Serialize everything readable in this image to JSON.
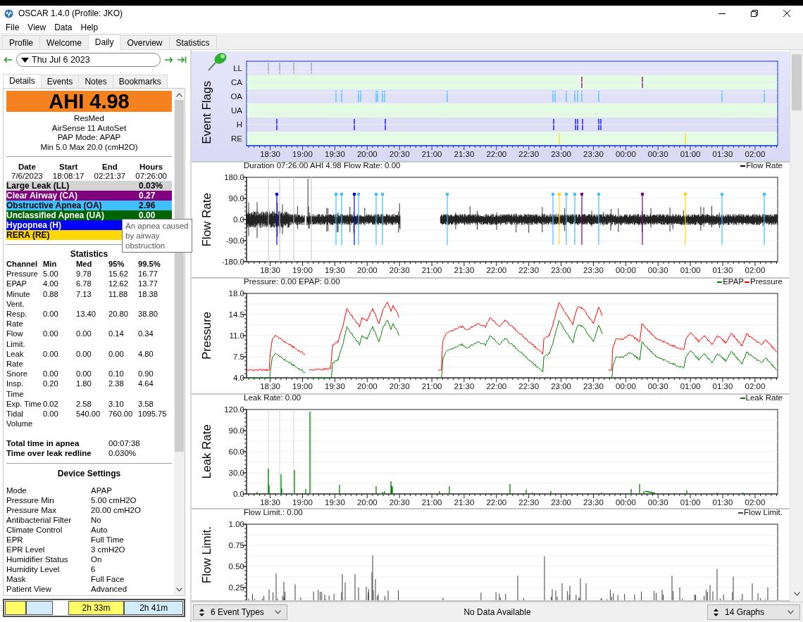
{
  "window": {
    "title": "OSCAR 1.4.0 (Profile: JKO)"
  },
  "menu": [
    "File",
    "View",
    "Data",
    "Help"
  ],
  "tabs": [
    {
      "label": "Profile",
      "selected": false
    },
    {
      "label": "Welcome",
      "selected": false
    },
    {
      "label": "Daily",
      "selected": true
    },
    {
      "label": "Overview",
      "selected": false
    },
    {
      "label": "Statistics",
      "selected": false
    }
  ],
  "date_nav": {
    "date": "Thu Jul 6 2023"
  },
  "detail_tabs": [
    {
      "label": "Details",
      "selected": true
    },
    {
      "label": "Events",
      "selected": false
    },
    {
      "label": "Notes",
      "selected": false
    },
    {
      "label": "Bookmarks",
      "selected": false
    }
  ],
  "summary": {
    "ahi": "AHI 4.98",
    "device": [
      "ResMed",
      "AirSense 11 AutoSet",
      "PAP Mode: APAP",
      "Min 5.0 Max 20.0 (cmH2O)"
    ]
  },
  "session": {
    "columns": [
      "Date",
      "Start",
      "End",
      "Hours"
    ],
    "values": [
      "7/6/2023",
      "18:08:17",
      "02:21:37",
      "07:26:00"
    ]
  },
  "indices": [
    {
      "label": "Large Leak (LL)",
      "value": "0.03%",
      "color": "#d3d3d3"
    },
    {
      "label": "Clear Airway (CA)",
      "value": "0.27",
      "color": "#800080"
    },
    {
      "label": "Obstructive Apnea (OA)",
      "value": "2.96",
      "color": "#40c0ff"
    },
    {
      "label": "Unclassified Apnea (UA)",
      "value": "0.00",
      "color": "#006400"
    },
    {
      "label": "Hypopnea (H)",
      "color": "#0000ff"
    },
    {
      "label": "RERA (RE)",
      "color": "#ffd700"
    }
  ],
  "tooltip": "An apnea caused by airway obstruction",
  "statistics": {
    "title": "Statistics",
    "columns": [
      "Channel",
      "Min",
      "Med",
      "95%",
      "99.5%"
    ],
    "rows": [
      [
        "Pressure",
        "5.00",
        "9.78",
        "15.62",
        "16.77"
      ],
      [
        "EPAP",
        "4.00",
        "6.78",
        "12.62",
        "13.77"
      ],
      [
        "Minute Vent.",
        "0.88",
        "7.13",
        "11.88",
        "18.38"
      ],
      [
        "Resp. Rate",
        "0.00",
        "13.40",
        "20.80",
        "38.80"
      ],
      [
        "Flow Limit.",
        "0.00",
        "0.00",
        "0.14",
        "0.34"
      ],
      [
        "Leak Rate",
        "0.00",
        "0.00",
        "0.00",
        "4.80"
      ],
      [
        "Snore",
        "0.00",
        "0.00",
        "0.10",
        "0.90"
      ],
      [
        "Insp. Time",
        "0.20",
        "1.80",
        "2.38",
        "4.64"
      ],
      [
        "Exp. Time",
        "0.02",
        "2.58",
        "3.10",
        "3.58"
      ],
      [
        "Tidal Volume",
        "0.00",
        "540.00",
        "760.00",
        "1095.75"
      ]
    ]
  },
  "totals": [
    {
      "label": "Total time in apnea",
      "value": "00:07:38"
    },
    {
      "label": "Time over leak redline",
      "value": "0.030%"
    }
  ],
  "device_settings": {
    "title": "Device Settings",
    "rows": [
      [
        "Mode",
        "APAP"
      ],
      [
        "Pressure Min",
        "5.00 cmH2O"
      ],
      [
        "Pressure Max",
        "20.00 cmH2O"
      ],
      [
        "Antibacterial Filter",
        "No"
      ],
      [
        "Climate Control",
        "Auto"
      ],
      [
        "EPR",
        "Full Time"
      ],
      [
        "EPR Level",
        "3 cmH2O"
      ],
      [
        "Humidifier Status",
        "On"
      ],
      [
        "Humidity Level",
        "6"
      ],
      [
        "Mask",
        "Full Face"
      ],
      [
        "Patient View",
        "Advanced"
      ]
    ]
  },
  "timeline": [
    {
      "kind": "session",
      "color": "#ffff66"
    },
    {
      "kind": "session",
      "color": "#d4ecfa"
    },
    {
      "kind": "gap"
    },
    {
      "kind": "session",
      "color": "#ffff66",
      "label": "2h 33m"
    },
    {
      "kind": "session",
      "color": "#d4ecfa",
      "label": "2h 41m"
    }
  ],
  "graphs": [
    {
      "kind": "flags",
      "title": "Event Flags",
      "rows": [
        "LL",
        "CA",
        "OA",
        "UA",
        "H",
        "RE"
      ],
      "xticks": [
        "18:30",
        "19:00",
        "19:30",
        "20:00",
        "20:30",
        "21:00",
        "21:30",
        "22:00",
        "22:30",
        "23:00",
        "23:30",
        "00:00",
        "00:30",
        "01:00",
        "01:30",
        "02:00"
      ]
    },
    {
      "kind": "flow",
      "title": "Flow Rate",
      "info": "Duration 07:26:00 AHI 4.98 Flow Rate: 0.00",
      "legend": [
        {
          "label": "Flow Rate",
          "color": "#000000"
        }
      ],
      "yticks": [
        "180.0",
        "90.0",
        "0.0",
        "-90.0",
        "-180.0"
      ],
      "xticks": [
        "18:30",
        "19:00",
        "19:30",
        "20:00",
        "20:30",
        "21:00",
        "21:30",
        "22:00",
        "22:30",
        "23:00",
        "23:30",
        "00:00",
        "00:30",
        "01:00",
        "01:30",
        "02:00"
      ]
    },
    {
      "kind": "pressure",
      "title": "Pressure",
      "info": "Pressure: 0.00 EPAP: 0.00",
      "legend": [
        {
          "label": "EPAP",
          "color": "#008000"
        },
        {
          "label": "Pressure",
          "color": "#ff0000"
        }
      ],
      "yticks": [
        "18.0",
        "14.5",
        "11.0",
        "7.5",
        "4.0"
      ],
      "xticks": [
        "18:30",
        "19:00",
        "19:30",
        "20:00",
        "20:30",
        "21:00",
        "21:30",
        "22:00",
        "22:30",
        "23:00",
        "23:30",
        "00:00",
        "00:30",
        "01:00",
        "01:30",
        "02:00"
      ]
    },
    {
      "kind": "leak",
      "title": "Leak Rate",
      "info": "Leak Rate: 0.00",
      "legend": [
        {
          "label": "Leak Rate",
          "color": "#008000"
        }
      ],
      "yticks": [
        "120.0",
        "90.0",
        "60.0",
        "30.0",
        "0.0"
      ],
      "xticks": [
        "18:30",
        "19:00",
        "19:30",
        "20:00",
        "20:30",
        "21:00",
        "21:30",
        "22:00",
        "22:30",
        "23:00",
        "23:30",
        "00:00",
        "00:30",
        "01:00",
        "01:30",
        "02:00"
      ]
    },
    {
      "kind": "flowlimit",
      "title": "Flow Limit.",
      "info": "Flow Limit.: 0.00",
      "legend": [
        {
          "label": "Flow Limit.",
          "color": "#404040"
        }
      ],
      "yticks": [
        "1.00",
        "0.75",
        "0.50",
        "0.25"
      ]
    }
  ],
  "bottom": {
    "event_types": "6 Event Types",
    "status": "No Data Available",
    "graph_count": "14 Graphs"
  }
}
